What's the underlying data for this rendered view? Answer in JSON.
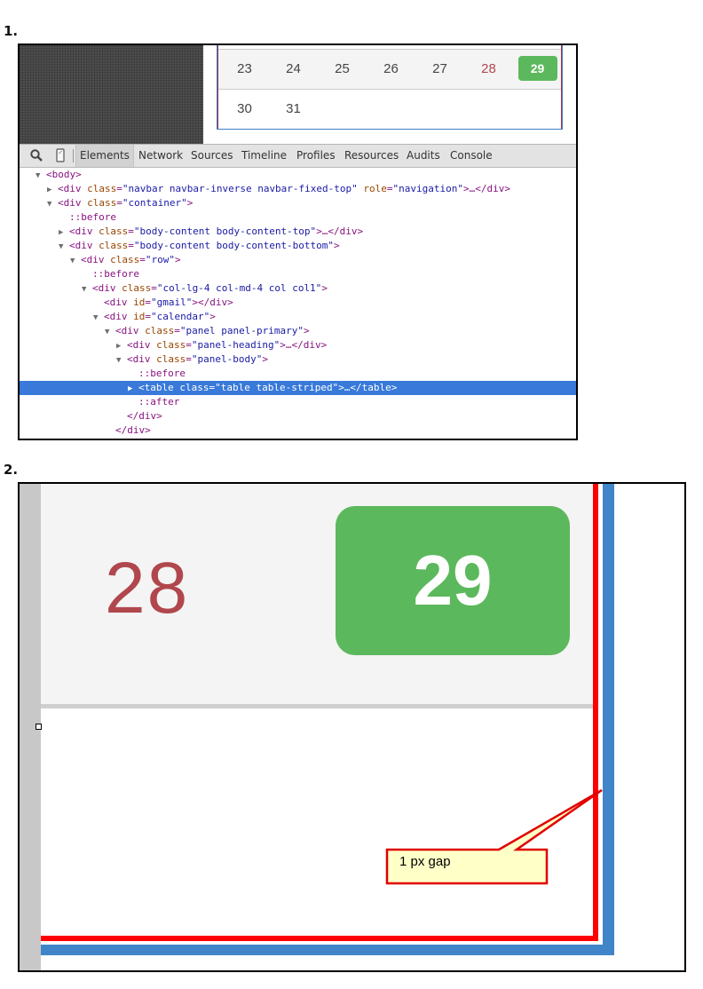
{
  "steps": [
    {
      "label": "1."
    },
    {
      "label": "2."
    }
  ],
  "calendar": {
    "rows": [
      [
        {
          "day": "23",
          "type": "normal"
        },
        {
          "day": "24",
          "type": "normal"
        },
        {
          "day": "25",
          "type": "normal"
        },
        {
          "day": "26",
          "type": "normal"
        },
        {
          "day": "27",
          "type": "normal"
        },
        {
          "day": "28",
          "type": "weekend"
        },
        {
          "day": "29",
          "type": "today"
        }
      ],
      [
        {
          "day": "30",
          "type": "normal"
        },
        {
          "day": "31",
          "type": "normal"
        }
      ]
    ],
    "colors": {
      "today_bg": "#5cb85c",
      "weekend_text": "#b0474d",
      "stripe_bg": "#f4f4f4"
    }
  },
  "devtools": {
    "icons": [
      "search-icon",
      "device-mode-icon"
    ],
    "tabs": [
      {
        "label": "Elements",
        "active": true
      },
      {
        "label": "Network",
        "active": false
      },
      {
        "label": "Sources",
        "active": false
      },
      {
        "label": "Timeline",
        "active": false
      },
      {
        "label": "Profiles",
        "active": false
      },
      {
        "label": "Resources",
        "active": false
      },
      {
        "label": "Audits",
        "active": false
      },
      {
        "label": "Console",
        "active": false
      }
    ],
    "selection_color": "#3879d9",
    "tree": [
      {
        "depth": 0,
        "toggle": "open",
        "text": "<body>"
      },
      {
        "depth": 1,
        "toggle": "closed",
        "text": "<div class=\"navbar navbar-inverse navbar-fixed-top\" role=\"navigation\">…</div>"
      },
      {
        "depth": 1,
        "toggle": "open",
        "text": "<div class=\"container\">"
      },
      {
        "depth": 2,
        "toggle": "none",
        "text": "::before"
      },
      {
        "depth": 2,
        "toggle": "closed",
        "text": "<div class=\"body-content body-content-top\">…</div>"
      },
      {
        "depth": 2,
        "toggle": "open",
        "text": "<div class=\"body-content body-content-bottom\">"
      },
      {
        "depth": 3,
        "toggle": "open",
        "text": "<div class=\"row\">"
      },
      {
        "depth": 4,
        "toggle": "none",
        "text": "::before"
      },
      {
        "depth": 4,
        "toggle": "open",
        "text": "<div class=\"col-lg-4 col-md-4 col col1\">"
      },
      {
        "depth": 5,
        "toggle": "none",
        "text": "<div id=\"gmail\"></div>"
      },
      {
        "depth": 5,
        "toggle": "open",
        "text": "<div id=\"calendar\">"
      },
      {
        "depth": 6,
        "toggle": "open",
        "text": "<div class=\"panel panel-primary\">"
      },
      {
        "depth": 7,
        "toggle": "closed",
        "text": "<div class=\"panel-heading\">…</div>"
      },
      {
        "depth": 7,
        "toggle": "open",
        "text": "<div class=\"panel-body\">"
      },
      {
        "depth": 8,
        "toggle": "none",
        "text": "::before"
      },
      {
        "depth": 8,
        "toggle": "closed",
        "text": "<table class=\"table table-striped\">…</table>",
        "selected": true
      },
      {
        "depth": 8,
        "toggle": "none",
        "text": "::after"
      },
      {
        "depth": 7,
        "toggle": "none",
        "text": "</div>"
      },
      {
        "depth": 6,
        "toggle": "none",
        "text": "</div>"
      }
    ]
  },
  "zoomed": {
    "weekend_day": "28",
    "today_day": "29",
    "callout": {
      "text": "1 px gap",
      "bg": "#ffffc8",
      "border": "#e00000"
    },
    "colors": {
      "red_border": "#ff0000",
      "blue_border": "#3f85c8"
    }
  }
}
